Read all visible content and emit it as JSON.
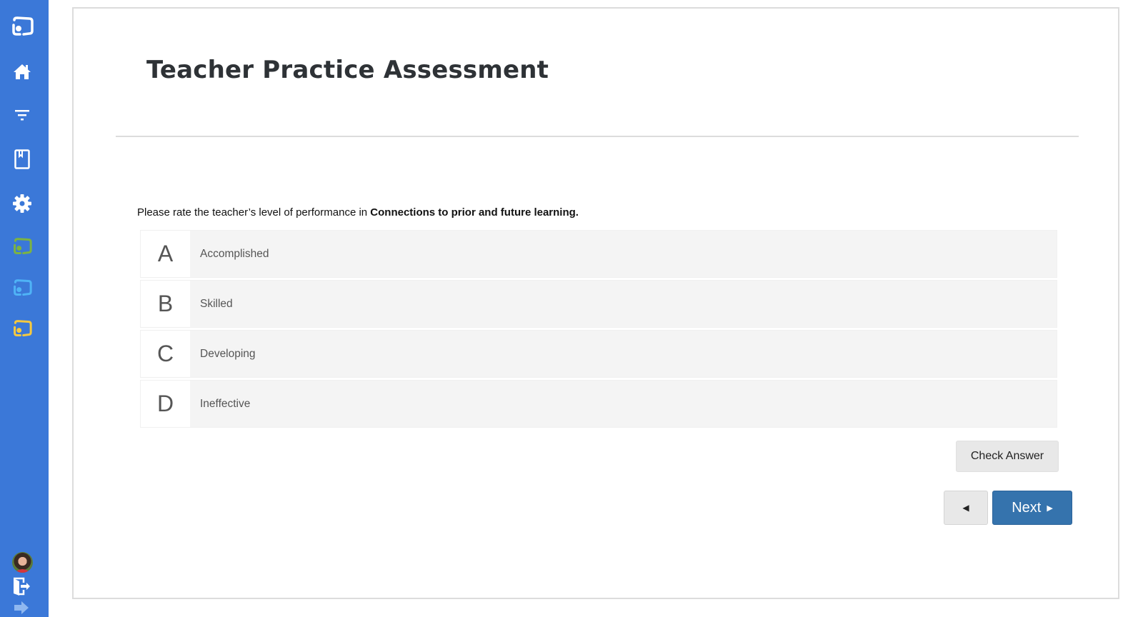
{
  "sidebar": {
    "items": [
      {
        "name": "app-logo-icon",
        "color": "#ffffff"
      },
      {
        "name": "home-icon",
        "color": "#ffffff"
      },
      {
        "name": "filter-icon",
        "color": "#ffffff"
      },
      {
        "name": "bookmark-book-icon",
        "color": "#ffffff"
      },
      {
        "name": "settings-gear-icon",
        "color": "#ffffff"
      },
      {
        "name": "app-logo-green-icon",
        "color": "#7cb342"
      },
      {
        "name": "app-logo-lightblue-icon",
        "color": "#4fb3f6"
      },
      {
        "name": "app-logo-yellow-icon",
        "color": "#f6c93f"
      }
    ],
    "bottom": {
      "avatar": "user-avatar",
      "logout": "logout-door-icon",
      "expand": "expand-arrow-icon"
    },
    "background": "#3b78d8"
  },
  "page": {
    "title": "Teacher Practice Assessment"
  },
  "question": {
    "prefix": "Please rate the teacher’s level of performance in ",
    "emphasis": "Connections to prior and future learning."
  },
  "options": [
    {
      "letter": "A",
      "label": "Accomplished"
    },
    {
      "letter": "B",
      "label": "Skilled"
    },
    {
      "letter": "C",
      "label": "Developing"
    },
    {
      "letter": "D",
      "label": "Ineffective"
    }
  ],
  "actions": {
    "check_answer": "Check Answer",
    "previous_glyph": "◀",
    "next_label": "Next",
    "next_glyph": "▶",
    "next_color": "#3573ad"
  }
}
